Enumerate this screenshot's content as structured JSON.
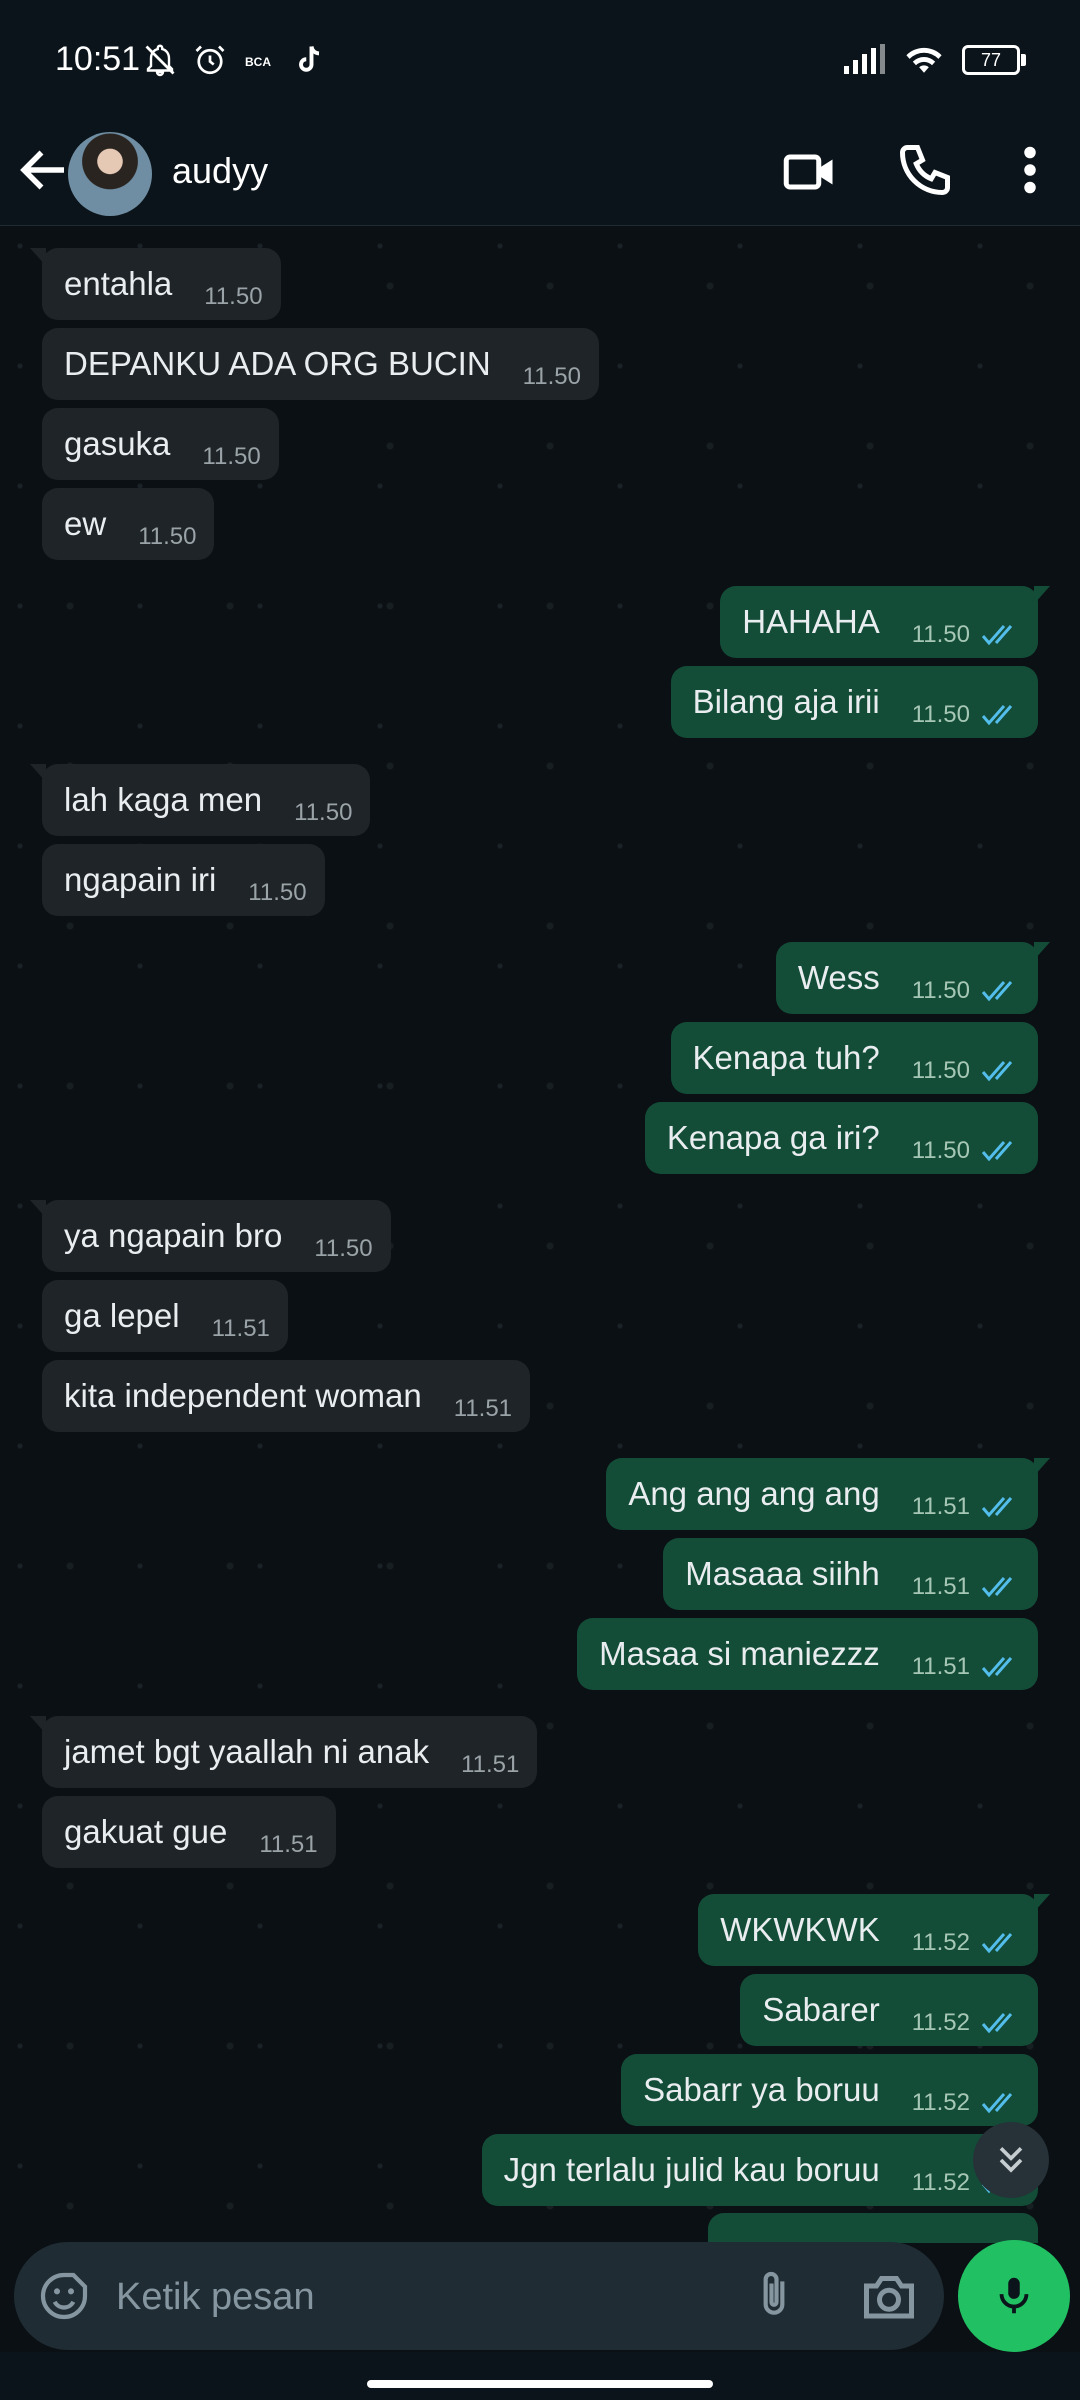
{
  "status_bar": {
    "time": "10:51",
    "battery": "77",
    "left_icons": [
      "notifications-off-icon",
      "alarm-icon",
      "bca-icon",
      "tiktok-icon"
    ],
    "right_icons": [
      "signal-icon",
      "wifi-icon",
      "battery-icon"
    ]
  },
  "header": {
    "contact_name": "audyy",
    "icons": [
      "back-arrow-icon",
      "video-call-icon",
      "phone-icon",
      "more-options-icon"
    ]
  },
  "colors": {
    "incoming_bubble": "#1f2428",
    "outgoing_bubble": "#134d37",
    "read_ticks": "#53bdeb",
    "accent_green": "#21c063"
  },
  "messages": [
    {
      "dir": "in",
      "text": "entahla",
      "time": "11.50"
    },
    {
      "dir": "in",
      "text": "DEPANKU ADA ORG BUCIN",
      "time": "11.50"
    },
    {
      "dir": "in",
      "text": "gasuka",
      "time": "11.50"
    },
    {
      "dir": "in",
      "text": "ew",
      "time": "11.50"
    },
    {
      "dir": "out",
      "text": "HAHAHA",
      "time": "11.50",
      "status": "read"
    },
    {
      "dir": "out",
      "text": "Bilang aja irii",
      "time": "11.50",
      "status": "read"
    },
    {
      "dir": "in",
      "text": "lah kaga men",
      "time": "11.50"
    },
    {
      "dir": "in",
      "text": "ngapain iri",
      "time": "11.50"
    },
    {
      "dir": "out",
      "text": "Wess",
      "time": "11.50",
      "status": "read"
    },
    {
      "dir": "out",
      "text": "Kenapa tuh?",
      "time": "11.50",
      "status": "read"
    },
    {
      "dir": "out",
      "text": "Kenapa ga iri?",
      "time": "11.50",
      "status": "read"
    },
    {
      "dir": "in",
      "text": "ya ngapain bro",
      "time": "11.50"
    },
    {
      "dir": "in",
      "text": "ga lepel",
      "time": "11.51"
    },
    {
      "dir": "in",
      "text": "kita independent woman",
      "time": "11.51"
    },
    {
      "dir": "out",
      "text": "Ang ang ang ang",
      "time": "11.51",
      "status": "read"
    },
    {
      "dir": "out",
      "text": "Masaaa siihh",
      "time": "11.51",
      "status": "read"
    },
    {
      "dir": "out",
      "text": "Masaa si maniezzz",
      "time": "11.51",
      "status": "read"
    },
    {
      "dir": "in",
      "text": "jamet bgt yaallah ni anak",
      "time": "11.51"
    },
    {
      "dir": "in",
      "text": "gakuat gue",
      "time": "11.51"
    },
    {
      "dir": "out",
      "text": "WKWKWK",
      "time": "11.52",
      "status": "read"
    },
    {
      "dir": "out",
      "text": "Sabarer",
      "time": "11.52",
      "status": "read"
    },
    {
      "dir": "out",
      "text": "Sabarr ya boruu",
      "time": "11.52",
      "status": "read"
    },
    {
      "dir": "out",
      "text": "Jgn terlalu julid kau boruu",
      "time": "11.52",
      "status": "read"
    }
  ],
  "composer": {
    "placeholder": "Ketik pesan",
    "icons": [
      "emoji-icon",
      "attach-icon",
      "camera-icon",
      "mic-icon"
    ]
  }
}
